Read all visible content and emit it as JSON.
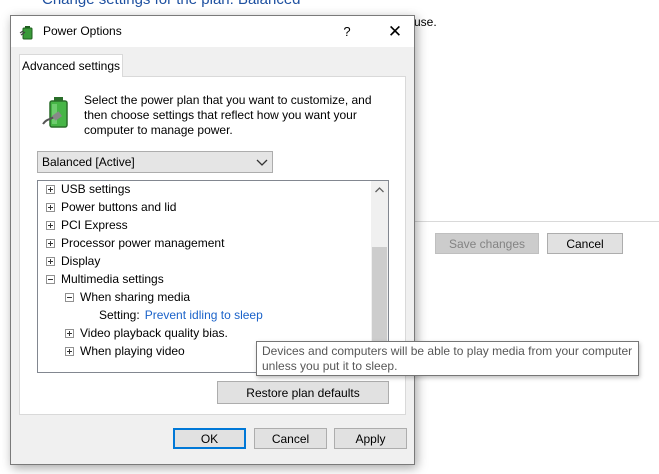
{
  "background": {
    "heading": "Change settings for the plan: Balanced",
    "text_fragment": "use.",
    "save_button": "Save changes",
    "cancel_button": "Cancel"
  },
  "dialog": {
    "title": "Power Options",
    "help_glyph": "?",
    "close_glyph": "✕",
    "tab": "Advanced settings",
    "intro": "Select the power plan that you want to customize, and then choose settings that reflect how you want your computer to manage power.",
    "plan_select": "Balanced [Active]",
    "tree": [
      {
        "label": "USB settings",
        "state": "collapsed"
      },
      {
        "label": "Power buttons and lid",
        "state": "collapsed"
      },
      {
        "label": "PCI Express",
        "state": "collapsed"
      },
      {
        "label": "Processor power management",
        "state": "collapsed"
      },
      {
        "label": "Display",
        "state": "collapsed"
      },
      {
        "label": "Multimedia settings",
        "state": "expanded"
      },
      {
        "label": "When sharing media",
        "state": "expanded"
      },
      {
        "label": "Setting:",
        "value": "Prevent idling to sleep"
      },
      {
        "label": "Video playback quality bias.",
        "state": "collapsed"
      },
      {
        "label": "When playing video",
        "state": "collapsed"
      }
    ],
    "restore_button": "Restore plan defaults",
    "ok_button": "OK",
    "cancel_button": "Cancel",
    "apply_button": "Apply"
  },
  "tooltip": "Devices and computers will be able to play media from your computer unless you put it to sleep.",
  "colors": {
    "link": "#1a62c9",
    "ok_border": "#0078d7",
    "heading": "#1e50a0"
  },
  "icons": [
    "power-options-icon",
    "battery-plug-icon",
    "chevron-down-icon",
    "scroll-up-icon",
    "help-icon",
    "close-icon"
  ]
}
